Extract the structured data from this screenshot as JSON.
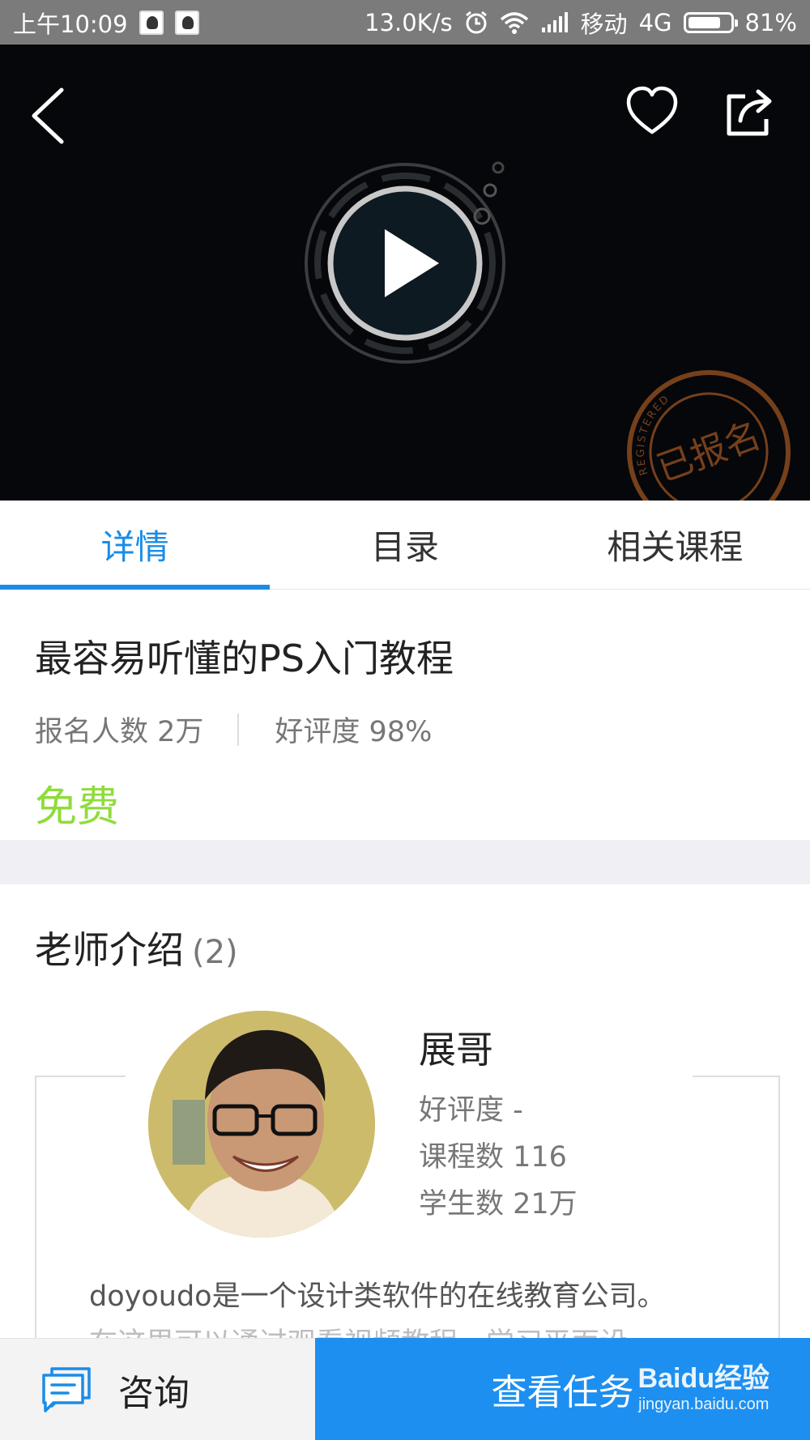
{
  "status_bar": {
    "time": "上午10:09",
    "net_speed": "13.0K/s",
    "carrier": "移动",
    "network": "4G",
    "battery": "81%",
    "battery_level": 0.81
  },
  "video": {
    "stamp_text": "已报名",
    "stamp_ring_text": "REGISTERED"
  },
  "tabs": [
    {
      "label": "详情",
      "active": true
    },
    {
      "label": "目录",
      "active": false
    },
    {
      "label": "相关课程",
      "active": false
    }
  ],
  "course": {
    "title": "最容易听懂的PS入门教程",
    "enrolled": "报名人数 2万",
    "rating": "好评度 98%",
    "price": "免费"
  },
  "teacher_section": {
    "heading": "老师介绍",
    "count": "(2)",
    "teacher": {
      "name": "展哥",
      "rating": "好评度 -",
      "courses": "课程数 116",
      "students": "学生数 21万",
      "desc_line1": "doyoudo是一个设计类软件的在线教育公司。",
      "desc_line2": "在这里可以通过观看视频教程，学习平面设"
    }
  },
  "bottom_bar": {
    "consult_label": "咨询",
    "tasks_label": "查看任务",
    "watermark_main": "Baidu经验",
    "watermark_sub": "jingyan.baidu.com"
  },
  "colors": {
    "accent": "#1a8ce8",
    "price": "#8fdc3a",
    "status_bar": "#7b7b7b",
    "video_bg": "#05070a",
    "stamp": "#8a4a1e"
  }
}
